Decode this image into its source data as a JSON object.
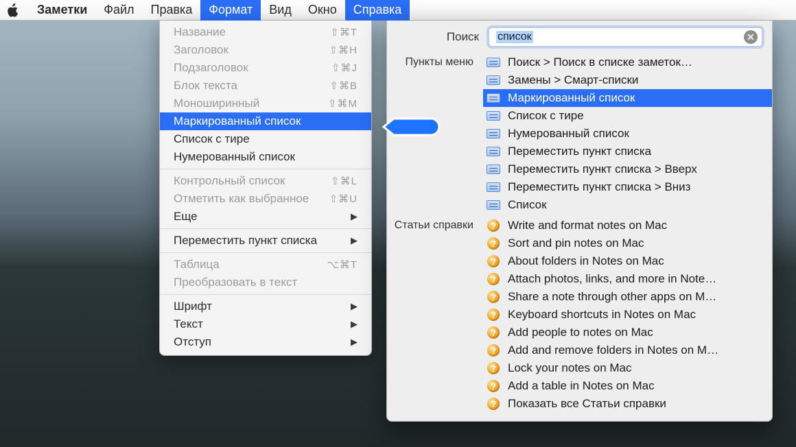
{
  "menubar": {
    "app": "Заметки",
    "items": [
      "Файл",
      "Правка",
      "Формат",
      "Вид",
      "Окно",
      "Справка"
    ]
  },
  "format_menu": {
    "items": [
      {
        "label": "Название",
        "shortcut": "⇧⌘T",
        "disabled": true
      },
      {
        "label": "Заголовок",
        "shortcut": "⇧⌘H",
        "disabled": true
      },
      {
        "label": "Подзаголовок",
        "shortcut": "⇧⌘J",
        "disabled": true
      },
      {
        "label": "Блок текста",
        "shortcut": "⇧⌘B",
        "disabled": true
      },
      {
        "label": "Моноширинный",
        "shortcut": "⇧⌘M",
        "disabled": true
      },
      {
        "label": "Маркированный список",
        "selected": true
      },
      {
        "label": "Список с тире"
      },
      {
        "label": "Нумерованный список"
      },
      {
        "sep": true
      },
      {
        "label": "Контрольный список",
        "shortcut": "⇧⌘L",
        "disabled": true
      },
      {
        "label": "Отметить как выбранное",
        "shortcut": "⇧⌘U",
        "disabled": true
      },
      {
        "label": "Еще",
        "submenu": true
      },
      {
        "sep": true
      },
      {
        "label": "Переместить пункт списка",
        "submenu": true
      },
      {
        "sep": true
      },
      {
        "label": "Таблица",
        "shortcut": "⌥⌘T",
        "disabled": true
      },
      {
        "label": "Преобразовать в текст",
        "disabled": true
      },
      {
        "sep": true
      },
      {
        "label": "Шрифт",
        "submenu": true
      },
      {
        "label": "Текст",
        "submenu": true
      },
      {
        "label": "Отступ",
        "submenu": true
      }
    ]
  },
  "help": {
    "search_label": "Поиск",
    "search_value": "список",
    "menu_section_label": "Пункты меню",
    "menu_results": [
      {
        "label": "Поиск > Поиск в списке заметок…"
      },
      {
        "label": "Замены > Смарт-списки"
      },
      {
        "label": "Маркированный список",
        "selected": true
      },
      {
        "label": "Список с тире"
      },
      {
        "label": "Нумерованный список"
      },
      {
        "label": "Переместить пункт списка"
      },
      {
        "label": "Переместить пункт списка > Вверх"
      },
      {
        "label": "Переместить пункт списка > Вниз"
      },
      {
        "label": "Список"
      }
    ],
    "articles_section_label": "Статьи справки",
    "article_results": [
      {
        "label": "Write and format notes on Mac"
      },
      {
        "label": "Sort and pin notes on Mac"
      },
      {
        "label": "About folders in Notes on Mac"
      },
      {
        "label": "Attach photos, links, and more in Note…"
      },
      {
        "label": "Share a note through other apps on M…"
      },
      {
        "label": "Keyboard shortcuts in Notes on Mac"
      },
      {
        "label": "Add people to notes on Mac"
      },
      {
        "label": "Add and remove folders in Notes on M…"
      },
      {
        "label": "Lock your notes on Mac"
      },
      {
        "label": "Add a table in Notes on Mac"
      },
      {
        "label": "Показать все Статьи справки"
      }
    ]
  }
}
